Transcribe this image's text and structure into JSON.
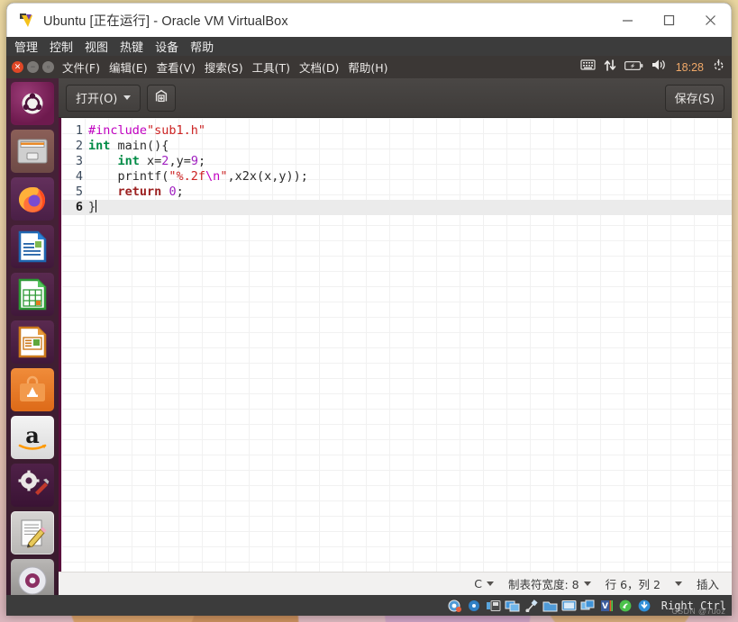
{
  "vbox": {
    "title": "Ubuntu [正在运行] - Oracle VM VirtualBox",
    "window_controls": {
      "minimize": "—",
      "maximize": "▢",
      "close": "✕"
    },
    "menus": [
      "管理",
      "控制",
      "视图",
      "热键",
      "设备",
      "帮助"
    ],
    "status_icons": [
      "harddisk-icon",
      "optical-disk-icon",
      "floppy-icon",
      "network-icon",
      "usb-icon",
      "shared-folders-icon",
      "display-icon",
      "recording-icon",
      "virtual-machine-icon",
      "mouse-integration-icon",
      "host-key-icon"
    ],
    "host_key": "Right Ctrl",
    "watermark": "CSDN @7uoz"
  },
  "ubuntu_panel": {
    "window_buttons": [
      "close",
      "minimize",
      "maximize"
    ],
    "menus": [
      "文件(F)",
      "编辑(E)",
      "查看(V)",
      "搜索(S)",
      "工具(T)",
      "文档(D)",
      "帮助(H)"
    ],
    "indicators": [
      "keyboard-icon",
      "network-icon",
      "battery-icon",
      "volume-icon"
    ],
    "clock": "18:28",
    "session_icon": "power-gear-icon"
  },
  "launcher": {
    "items": [
      {
        "name": "ubuntu-dash-icon",
        "label": "Ubuntu"
      },
      {
        "name": "files-icon",
        "label": "文件"
      },
      {
        "name": "firefox-icon",
        "label": "Firefox"
      },
      {
        "name": "libreoffice-writer-icon",
        "label": "LibreOffice Writer"
      },
      {
        "name": "libreoffice-calc-icon",
        "label": "LibreOffice Calc"
      },
      {
        "name": "libreoffice-impress-icon",
        "label": "LibreOffice Impress"
      },
      {
        "name": "ubuntu-software-icon",
        "label": "Ubuntu 软件"
      },
      {
        "name": "amazon-icon",
        "label": "Amazon"
      },
      {
        "name": "system-settings-icon",
        "label": "系统设置"
      },
      {
        "name": "text-editor-icon",
        "label": "文本编辑器"
      },
      {
        "name": "disc-icon",
        "label": "光盘"
      }
    ]
  },
  "gedit": {
    "toolbar": {
      "open_label": "打开(O)",
      "saveas_icon": "save-as-icon",
      "save_label": "保存(S)"
    },
    "code_lines": [
      {
        "n": "1",
        "current": false,
        "tokens": [
          {
            "t": "#include",
            "c": "k-pre"
          },
          {
            "t": "\"sub1.h\"",
            "c": "k-str"
          }
        ]
      },
      {
        "n": "2",
        "current": false,
        "tokens": [
          {
            "t": "int",
            "c": "k-type"
          },
          {
            "t": " main(){",
            "c": "src"
          }
        ]
      },
      {
        "n": "3",
        "current": false,
        "tokens": [
          {
            "t": "    ",
            "c": "src"
          },
          {
            "t": "int",
            "c": "k-type"
          },
          {
            "t": " x=",
            "c": "src"
          },
          {
            "t": "2",
            "c": "k-num"
          },
          {
            "t": ",y=",
            "c": "src"
          },
          {
            "t": "9",
            "c": "k-num"
          },
          {
            "t": ";",
            "c": "src"
          }
        ]
      },
      {
        "n": "4",
        "current": false,
        "tokens": [
          {
            "t": "    printf(",
            "c": "src"
          },
          {
            "t": "\"%.2f",
            "c": "k-str"
          },
          {
            "t": "\\n",
            "c": "k-esc"
          },
          {
            "t": "\"",
            "c": "k-str"
          },
          {
            "t": ",x2x(x,y));",
            "c": "src"
          }
        ]
      },
      {
        "n": "5",
        "current": false,
        "tokens": [
          {
            "t": "    ",
            "c": "src"
          },
          {
            "t": "return",
            "c": "k-kw"
          },
          {
            "t": " ",
            "c": "src"
          },
          {
            "t": "0",
            "c": "k-num"
          },
          {
            "t": ";",
            "c": "src"
          }
        ]
      },
      {
        "n": "6",
        "current": true,
        "tokens": [
          {
            "t": "}",
            "c": "src"
          }
        ]
      }
    ],
    "statusbar": {
      "language": "C",
      "tab_width": "制表符宽度: 8",
      "cursor_position": "行 6，列 2",
      "insert_mode": "插入"
    }
  },
  "colors": {
    "vbox_chrome": "#3c3c3c",
    "ubuntu_panel": "#3b3735",
    "launcher": "#3a122a",
    "gedit_header": "#443f3d",
    "editor_left_accent": "#5a0f3c",
    "clock_accent": "#f0a868",
    "current_line": "#ebebeb",
    "string_token": "#cc2222",
    "type_token": "#008b45",
    "preproc_token": "#c000c0",
    "number_token": "#a020c0",
    "keyword_token": "#9c2020"
  }
}
